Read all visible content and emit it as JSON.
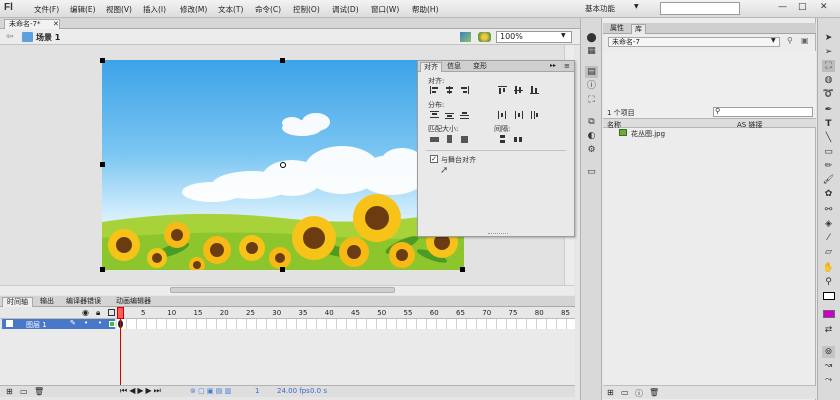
{
  "app": {
    "logo": "Fl",
    "menu": [
      "文件(F)",
      "编辑(E)",
      "视图(V)",
      "插入(I)",
      "修改(M)",
      "文本(T)",
      "命令(C)",
      "控制(O)",
      "调试(D)",
      "窗口(W)",
      "帮助(H)"
    ],
    "workspace": "基本功能",
    "window_buttons": [
      "—",
      "□",
      "✕"
    ]
  },
  "document": {
    "tab_title": "未命名-7*",
    "scene": "场景 1",
    "zoom": "100%"
  },
  "align_panel": {
    "tabs": [
      "对齐",
      "信息",
      "变形"
    ],
    "align_label": "对齐:",
    "distribute_label": "分布:",
    "match_size_label": "匹配大小:",
    "spacing_label": "间隔:",
    "stage_align_label": "与舞台对齐",
    "stage_align_checked": true
  },
  "timeline": {
    "tabs": [
      "时间轴",
      "输出",
      "编译器错误",
      "动画编辑器"
    ],
    "frame_numbers": [
      "1",
      "5",
      "10",
      "15",
      "20",
      "25",
      "30",
      "35",
      "40",
      "45",
      "50",
      "55",
      "60",
      "65",
      "70",
      "75",
      "80",
      "85"
    ],
    "layer_name": "图层 1",
    "current_frame": "1",
    "fps": "24.00 fps",
    "elapsed": "0.0 s"
  },
  "library": {
    "tabs": [
      "属性",
      "库"
    ],
    "document_select": "未命名-7",
    "item_count": "1 个项目",
    "col_name": "名称",
    "col_linkage": "AS 链接",
    "items": [
      {
        "name": "花丛图.jpg"
      }
    ]
  },
  "colors": {
    "stroke_swatch": "#000000",
    "fill_swatch": "#cc00cc",
    "layer_highlight": "#4a78c9"
  }
}
